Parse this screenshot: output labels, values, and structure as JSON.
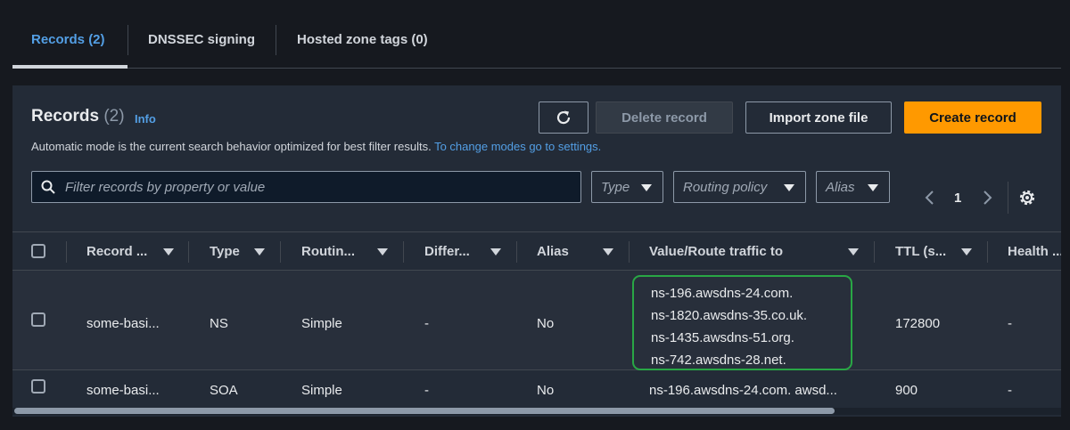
{
  "tabs": [
    {
      "label": "Records (2)"
    },
    {
      "label": "DNSSEC signing"
    },
    {
      "label": "Hosted zone tags (0)"
    }
  ],
  "header": {
    "title": "Records",
    "count": "(2)",
    "info": "Info",
    "description": "Automatic mode is the current search behavior optimized for best filter results.",
    "description_link": "To change modes go to settings."
  },
  "actions": {
    "delete_label": "Delete record",
    "import_label": "Import zone file",
    "create_label": "Create record"
  },
  "search": {
    "placeholder": "Filter records by property or value"
  },
  "filters": {
    "type": "Type",
    "routing": "Routing policy",
    "alias": "Alias"
  },
  "pagination": {
    "page": "1"
  },
  "columns": [
    "Record ...",
    "Type",
    "Routin...",
    "Differ...",
    "Alias",
    "Value/Route traffic to",
    "TTL (s...",
    "Health ..."
  ],
  "rows": [
    {
      "name": "some-basi...",
      "type": "NS",
      "routing": "Simple",
      "differentiator": "-",
      "alias": "No",
      "values": [
        "ns-196.awsdns-24.com.",
        "ns-1820.awsdns-35.co.uk.",
        "ns-1435.awsdns-51.org.",
        "ns-742.awsdns-28.net."
      ],
      "ttl": "172800",
      "health": "-"
    },
    {
      "name": "some-basi...",
      "type": "SOA",
      "routing": "Simple",
      "differentiator": "-",
      "alias": "No",
      "value": "ns-196.awsdns-24.com. awsd...",
      "ttl": "900",
      "health": "-"
    }
  ],
  "colors": {
    "accent": "#539fe5",
    "primary_button": "#ff9900",
    "highlight": "#29a745"
  }
}
